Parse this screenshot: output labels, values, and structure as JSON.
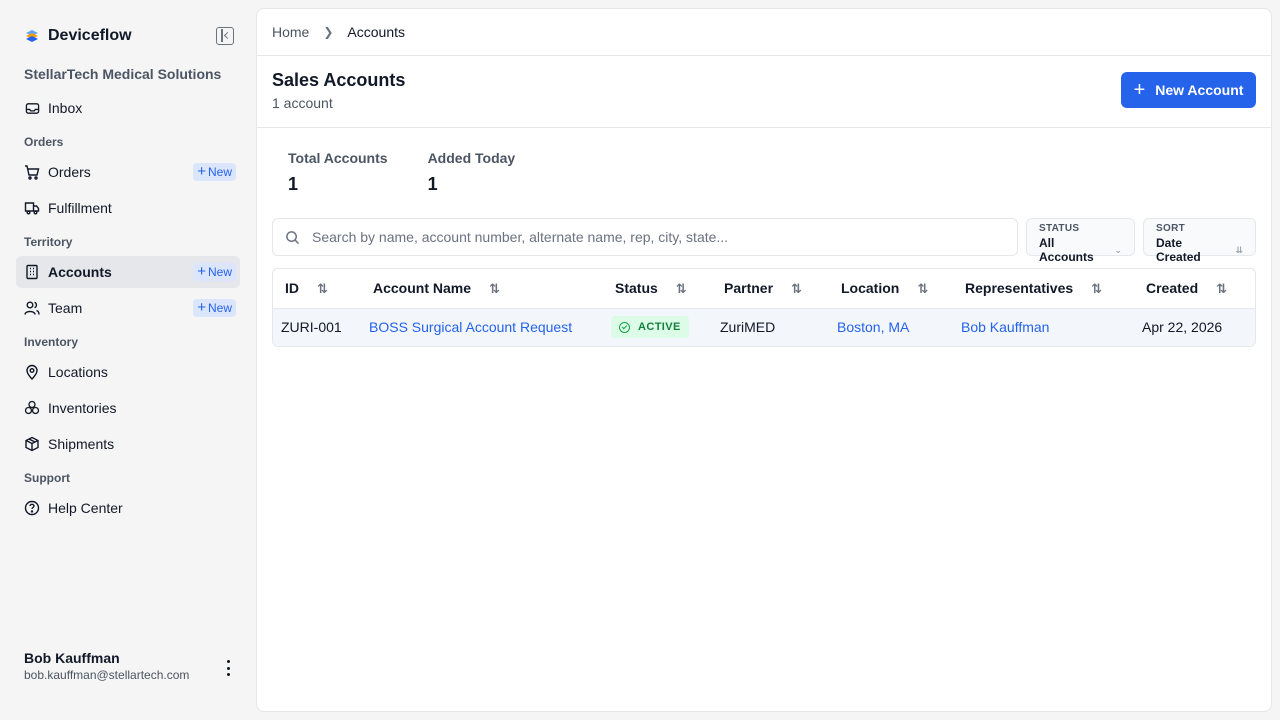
{
  "app": {
    "name": "Deviceflow",
    "org": "StellarTech Medical Solutions"
  },
  "sidebar": {
    "inbox": "Inbox",
    "sections": {
      "orders": "Orders",
      "territory": "Territory",
      "inventory": "Inventory",
      "support": "Support"
    },
    "items": {
      "orders": "Orders",
      "fulfillment": "Fulfillment",
      "accounts": "Accounts",
      "team": "Team",
      "locations": "Locations",
      "inventories": "Inventories",
      "shipments": "Shipments",
      "help": "Help Center"
    },
    "new_label": "New"
  },
  "user": {
    "name": "Bob Kauffman",
    "email": "bob.kauffman@stellartech.com"
  },
  "breadcrumb": {
    "home": "Home",
    "current": "Accounts"
  },
  "header": {
    "title": "Sales Accounts",
    "subtitle": "1 account",
    "new_button": "New Account"
  },
  "stats": {
    "total_label": "Total Accounts",
    "total_value": "1",
    "today_label": "Added Today",
    "today_value": "1"
  },
  "filters": {
    "search_placeholder": "Search by name, account number, alternate name, rep, city, state...",
    "status_label": "STATUS",
    "status_value": "All Accounts",
    "sort_label": "SORT",
    "sort_value": "Date Created"
  },
  "table": {
    "columns": [
      "ID",
      "Account Name",
      "Status",
      "Partner",
      "Location",
      "Representatives",
      "Created"
    ],
    "rows": [
      {
        "id": "ZURI-001",
        "name": "BOSS Surgical Account Request",
        "status": "ACTIVE",
        "partner": "ZuriMED",
        "location": "Boston, MA",
        "rep": "Bob Kauffman",
        "created": "Apr 22, 2026"
      }
    ]
  },
  "colors": {
    "accent": "#2563eb",
    "active_bg": "#dcfce7",
    "active_fg": "#15803d"
  }
}
